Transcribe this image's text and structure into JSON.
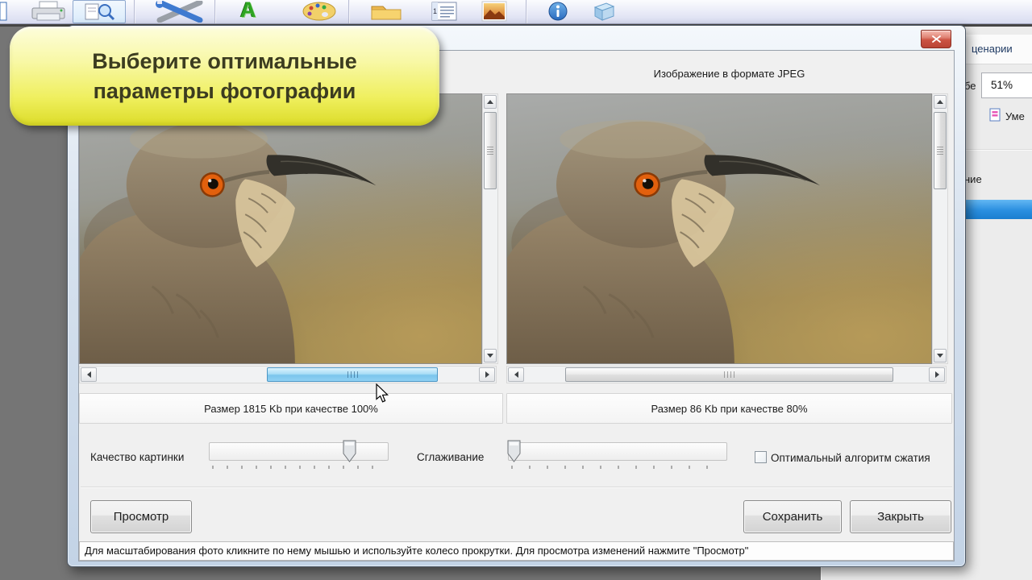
{
  "toolbar": {
    "font_glyph": "A",
    "icons": [
      "document",
      "print",
      "preview",
      "tools",
      "font",
      "palette",
      "folder",
      "calendar",
      "image",
      "info",
      "exit"
    ]
  },
  "balloon": {
    "line1": "Выберите оптимальные",
    "line2": "параметры фотографии"
  },
  "dialog": {
    "jpeg_panel_title": "Изображение в формате JPEG",
    "original_size_label": "Размер 1815 Kb при качестве 100%",
    "compressed_size_label": "Размер 86 Kb при качестве 80%",
    "quality_label": "Качество картинки",
    "smoothing_label": "Сглаживание",
    "quality_value_percent": 80,
    "smoothing_value_percent": 0,
    "optimal_checkbox_label": "Оптимальный алгоритм сжатия",
    "optimal_checkbox_checked": false,
    "preview_button_label": "Просмотр",
    "save_button_label": "Сохранить",
    "close_button_label": "Закрыть",
    "status_text": "Для масштабирования фото кликните по нему мышью и используйте колесо прокрутки. Для просмотра изменений нажмите \"Просмотр\""
  },
  "background_window": {
    "header_fragment": "ценарии",
    "label_fragment": "бе",
    "percent_value": "51%",
    "action_fragment": "Уме",
    "word_fragment": "ние"
  },
  "colors": {
    "selection_blue": "#2a8fe0",
    "balloon_yellow": "#efef5e",
    "scroll_thumb_blue": "#8fd0f2",
    "close_button_red": "#c9463d"
  }
}
